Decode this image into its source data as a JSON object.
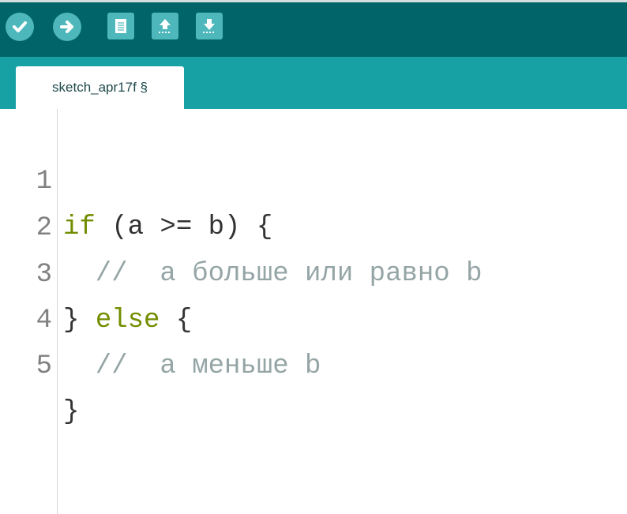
{
  "toolbar": {
    "buttons": [
      {
        "name": "verify-button",
        "icon": "check-icon"
      },
      {
        "name": "upload-button",
        "icon": "arrow-right-icon"
      },
      {
        "name": "new-button",
        "icon": "document-icon"
      },
      {
        "name": "open-button",
        "icon": "arrow-up-icon"
      },
      {
        "name": "save-button",
        "icon": "arrow-down-icon"
      }
    ],
    "colors": {
      "background": "#006468",
      "button": "#4db7bb"
    }
  },
  "tabs": [
    {
      "label": "sketch_apr17f §"
    }
  ],
  "editor": {
    "lines": [
      {
        "number": "1",
        "tokens": [
          {
            "text": "if",
            "type": "keyword"
          },
          {
            "text": " (a >= b) {",
            "type": "plain"
          }
        ]
      },
      {
        "number": "2",
        "tokens": [
          {
            "text": "  //  а больше или равно b",
            "type": "comment"
          }
        ]
      },
      {
        "number": "3",
        "tokens": [
          {
            "text": "} ",
            "type": "plain"
          },
          {
            "text": "else",
            "type": "keyword"
          },
          {
            "text": " {",
            "type": "plain"
          }
        ]
      },
      {
        "number": "4",
        "tokens": [
          {
            "text": "  //  а меньше b",
            "type": "comment"
          }
        ]
      },
      {
        "number": "5",
        "tokens": [
          {
            "text": "}",
            "type": "plain"
          }
        ]
      }
    ],
    "colors": {
      "keyword": "#728e00",
      "comment": "#95a5a6",
      "plain": "#333333",
      "line_number": "#808080"
    }
  }
}
